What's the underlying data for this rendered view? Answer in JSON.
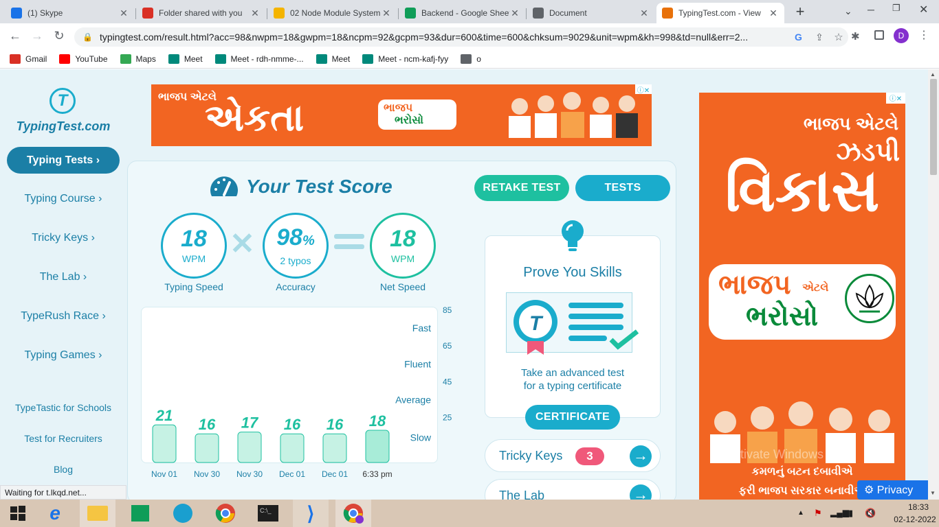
{
  "tabs": [
    {
      "title": "(1) Skype",
      "favicon": "skype-icon",
      "color": "#1a73e8"
    },
    {
      "title": "Folder shared with you",
      "favicon": "gmail-icon",
      "color": "#d93025"
    },
    {
      "title": "02 Node Module System",
      "favicon": "drive-icon",
      "color": "#f4b400"
    },
    {
      "title": "Backend - Google Sheets",
      "favicon": "sheets-icon",
      "color": "#0f9d58"
    },
    {
      "title": "Document",
      "favicon": "globe-icon",
      "color": "#5f6368"
    },
    {
      "title": "TypingTest.com - View",
      "favicon": "typingtest-icon",
      "color": "#e8710a"
    }
  ],
  "toolbar": {
    "url": "typingtest.com/result.html?acc=98&nwpm=18&gwpm=18&ncpm=92&gcpm=93&dur=600&time=600&chksum=9029&unit=wpm&kh=998&td=null&err=2...",
    "profile_initial": "D"
  },
  "bookmarks": [
    {
      "label": "Gmail",
      "icon": "gmail-icon",
      "color": "#d93025"
    },
    {
      "label": "YouTube",
      "icon": "youtube-icon",
      "color": "#ff0000"
    },
    {
      "label": "Maps",
      "icon": "maps-icon",
      "color": "#34a853"
    },
    {
      "label": "Meet",
      "icon": "meet-icon",
      "color": "#00897b"
    },
    {
      "label": "Meet - rdh-nmme-...",
      "icon": "meet-icon",
      "color": "#00897b"
    },
    {
      "label": "Meet",
      "icon": "meet-icon",
      "color": "#00897b"
    },
    {
      "label": "Meet - ncm-kafj-fyy",
      "icon": "meet-icon",
      "color": "#00897b"
    },
    {
      "label": "o",
      "icon": "globe-icon",
      "color": "#5f6368"
    }
  ],
  "sidebar": {
    "logo": "TypingTest.com",
    "items": [
      {
        "label": "Typing Tests ›",
        "active": true
      },
      {
        "label": "Typing Course ›"
      },
      {
        "label": "Tricky Keys ›"
      },
      {
        "label": "The Lab ›"
      },
      {
        "label": "TypeRush Race ›"
      },
      {
        "label": "Typing Games ›"
      }
    ],
    "links": [
      "TypeTastic for Schools",
      "Test for Recruiters",
      "Blog"
    ]
  },
  "score": {
    "title": "Your Test Score",
    "retake": "RETAKE TEST",
    "tests": "TESTS",
    "speed": {
      "value": "18",
      "unit": "WPM",
      "label": "Typing Speed"
    },
    "accuracy": {
      "value": "98",
      "pct": "%",
      "unit": "2 typos",
      "label": "Accuracy"
    },
    "net": {
      "value": "18",
      "unit": "WPM",
      "label": "Net Speed"
    }
  },
  "chart_data": {
    "type": "bar",
    "categories": [
      "Nov 01",
      "Nov 30",
      "Nov 30",
      "Dec 01",
      "Dec 01",
      "6:33 pm"
    ],
    "values": [
      21,
      16,
      17,
      16,
      16,
      18
    ],
    "yticks": [
      25,
      45,
      65,
      85
    ],
    "bands": [
      "Slow",
      "Average",
      "Fluent",
      "Fast"
    ],
    "ylim": [
      0,
      85
    ],
    "grid": false
  },
  "prove": {
    "title": "Prove You Skills",
    "desc1": "Take an advanced test",
    "desc2": "for a typing certificate",
    "button": "CERTIFICATE"
  },
  "tricky": {
    "label": "Tricky Keys",
    "badge": "3"
  },
  "lab": {
    "label": "The Lab"
  },
  "ads": {
    "top_line1": "ભાજપ એટલે",
    "top_line2": "એકતા",
    "top_badge_1": "ભાજપ",
    "top_badge_2": "ભરોસો",
    "right_line1": "ભાજપ એટલે",
    "right_line2": "ઝડપી",
    "right_line3": "વિકાસ",
    "right_badge_1": "ભાજપ",
    "right_badge_small": "એટલે",
    "right_badge_2": "ભરોસો",
    "right_footer1": "કમળનું બટન દબાવીએ",
    "right_footer2": "ફરી ભાજપ સરકાર બનાવીએ",
    "watermark": "Activate Windows",
    "privacy": "Privacy"
  },
  "status": "Waiting for t.lkqd.net...",
  "taskbar": {
    "time": "18:33",
    "date": "02-12-2022"
  }
}
